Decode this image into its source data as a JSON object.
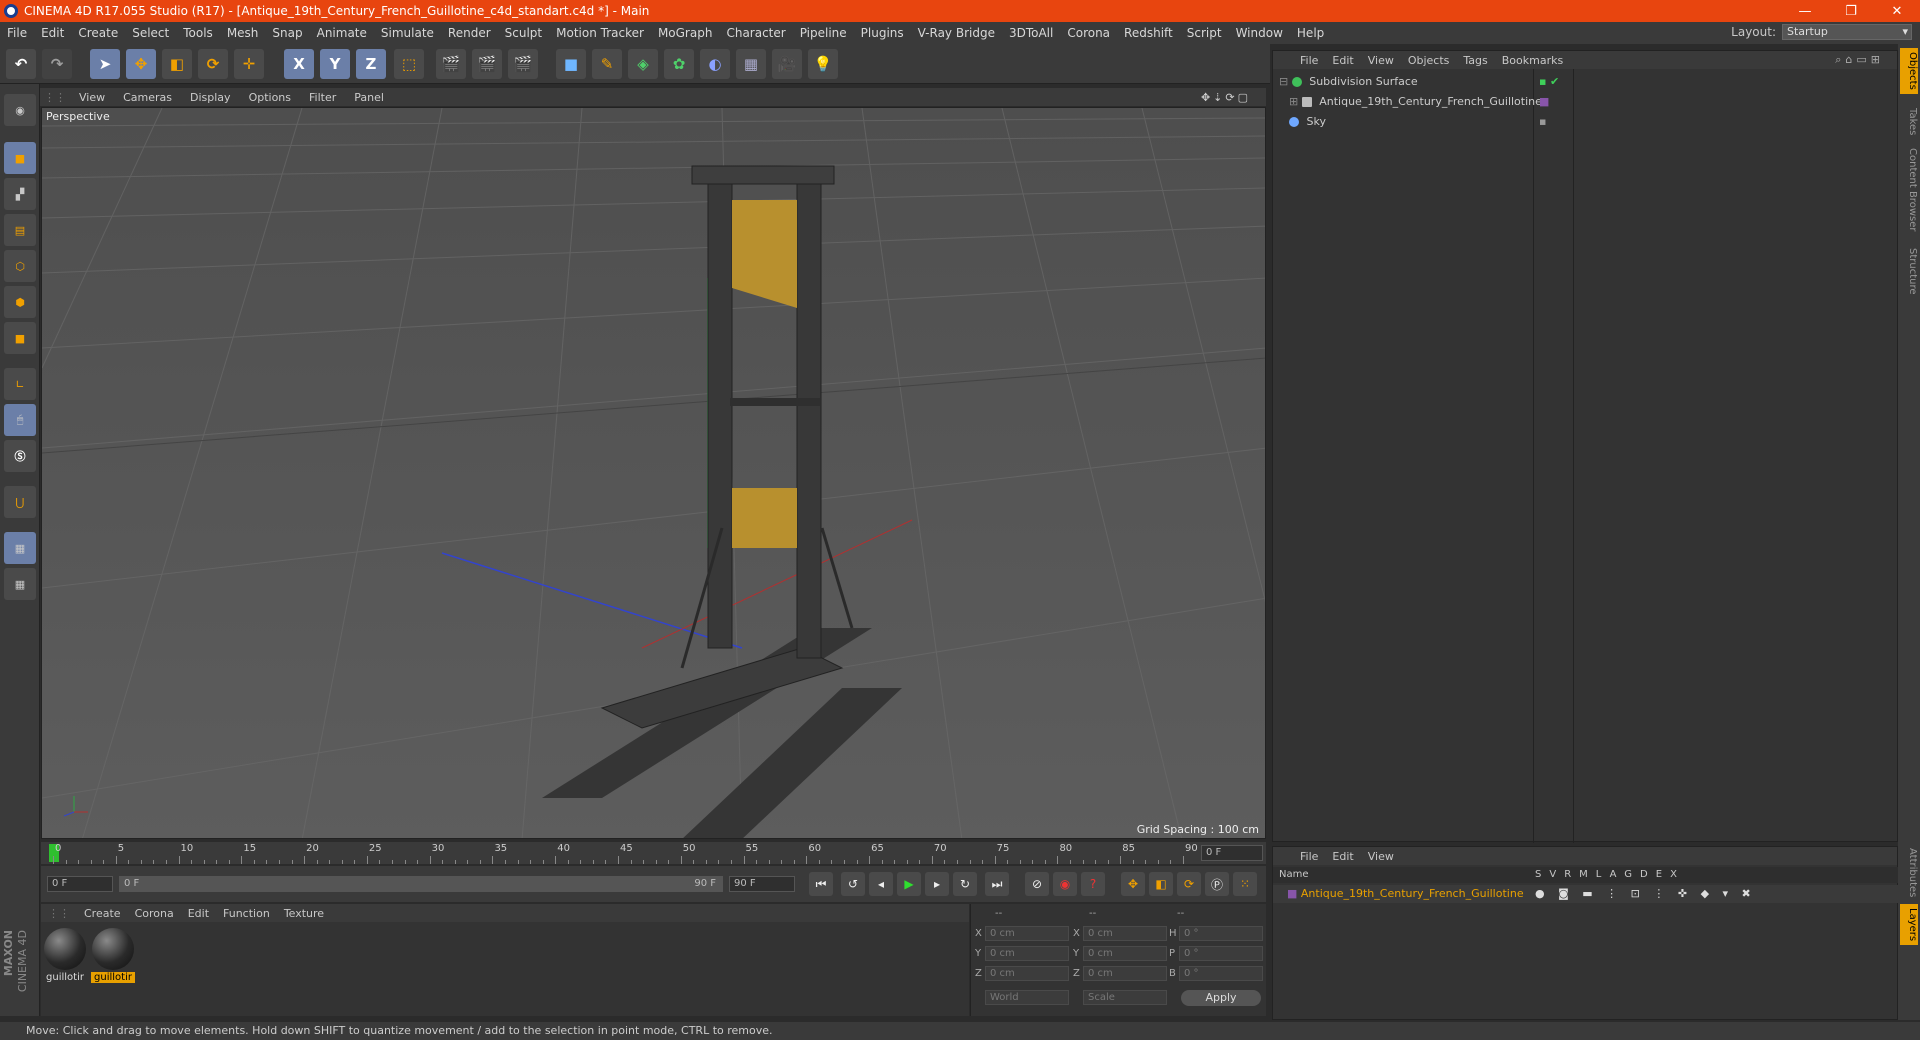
{
  "titlebar": {
    "title": "CINEMA 4D R17.055 Studio (R17) - [Antique_19th_Century_French_Guillotine_c4d_standart.c4d *] - Main",
    "minimize": "—",
    "maximize": "❐",
    "close": "✕"
  },
  "menubar": {
    "items": [
      "File",
      "Edit",
      "Create",
      "Select",
      "Tools",
      "Mesh",
      "Snap",
      "Animate",
      "Simulate",
      "Render",
      "Sculpt",
      "Motion Tracker",
      "MoGraph",
      "Character",
      "Pipeline",
      "Plugins",
      "V-Ray Bridge",
      "3DToAll",
      "Corona",
      "Redshift",
      "Script",
      "Window",
      "Help"
    ],
    "layout_label": "Layout:",
    "layout_value": "Startup"
  },
  "toolbar": {
    "axis_x": "X",
    "axis_y": "Y",
    "axis_z": "Z"
  },
  "viewport": {
    "menu": [
      "View",
      "Cameras",
      "Display",
      "Options",
      "Filter",
      "Panel"
    ],
    "camera_label": "Perspective",
    "grid_spacing": "Grid Spacing : 100 cm"
  },
  "timeline": {
    "ticks": [
      "0",
      "5",
      "10",
      "15",
      "20",
      "25",
      "30",
      "35",
      "40",
      "45",
      "50",
      "55",
      "60",
      "65",
      "70",
      "75",
      "80",
      "85",
      "90"
    ],
    "current_frame": "0 F",
    "start_field": "0 F",
    "range_start": "0 F",
    "range_end": "90 F",
    "end_field": "90 F"
  },
  "materials": {
    "menu": [
      "Create",
      "Corona",
      "Edit",
      "Function",
      "Texture"
    ],
    "items": [
      {
        "label": "guillotir",
        "selected": false
      },
      {
        "label": "guillotir",
        "selected": true
      }
    ]
  },
  "coordinates": {
    "header": [
      "--",
      "--",
      "--"
    ],
    "rows": [
      {
        "a": "X",
        "av": "0 cm",
        "b": "X",
        "bv": "0 cm",
        "c": "H",
        "cv": "0 °"
      },
      {
        "a": "Y",
        "av": "0 cm",
        "b": "Y",
        "bv": "0 cm",
        "c": "P",
        "cv": "0 °"
      },
      {
        "a": "Z",
        "av": "0 cm",
        "b": "Z",
        "bv": "0 cm",
        "c": "B",
        "cv": "0 °"
      }
    ],
    "mode1": "World",
    "mode2": "Scale",
    "apply": "Apply"
  },
  "objects": {
    "menu": [
      "File",
      "Edit",
      "View",
      "Objects",
      "Tags",
      "Bookmarks"
    ],
    "items": [
      {
        "name": "Subdivision Surface"
      },
      {
        "name": "Antique_19th_Century_French_Guillotine"
      },
      {
        "name": "Sky"
      }
    ]
  },
  "layers": {
    "menu": [
      "File",
      "Edit",
      "View"
    ],
    "col_name": "Name",
    "cols": [
      "S",
      "V",
      "R",
      "M",
      "L",
      "A",
      "G",
      "D",
      "E",
      "X"
    ],
    "row": "Antique_19th_Century_French_Guillotine"
  },
  "sidetabs": [
    "Objects",
    "Takes",
    "Content Browser",
    "Structure",
    "Attributes",
    "Layers"
  ],
  "status": "Move: Click and drag to move elements. Hold down SHIFT to quantize movement / add to the selection in point mode, CTRL to remove.",
  "brand": {
    "line1": "MAXON",
    "line2": "CINEMA 4D"
  },
  "colors": {
    "accent": "#e8450f",
    "selection": "#e8a000",
    "active_tool": "#6b7fa8"
  }
}
